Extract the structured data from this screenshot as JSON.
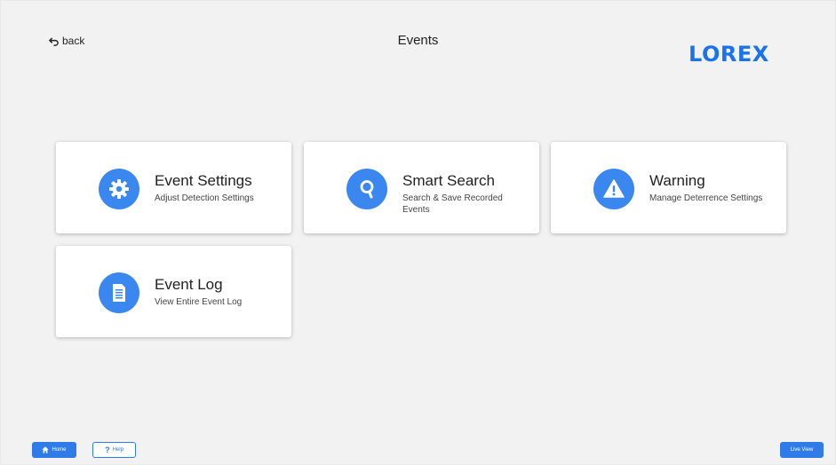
{
  "header": {
    "back_label": "back",
    "title": "Events",
    "logo_text": "LOREX"
  },
  "cards": [
    {
      "title": "Event Settings",
      "subtitle": "Adjust Detection Settings",
      "icon": "gear-icon"
    },
    {
      "title": "Smart Search",
      "subtitle": "Search & Save Recorded Events",
      "icon": "search-icon"
    },
    {
      "title": "Warning",
      "subtitle": "Manage Deterrence Settings",
      "icon": "warning-icon"
    },
    {
      "title": "Event Log",
      "subtitle": "View Entire Event Log",
      "icon": "document-icon"
    }
  ],
  "footer": {
    "home_label": "Home",
    "help_label": "Help",
    "live_view_label": "Live View"
  },
  "colors": {
    "accent": "#3b87f0",
    "brand": "#1a73e8",
    "background": "#f2f2f2"
  }
}
